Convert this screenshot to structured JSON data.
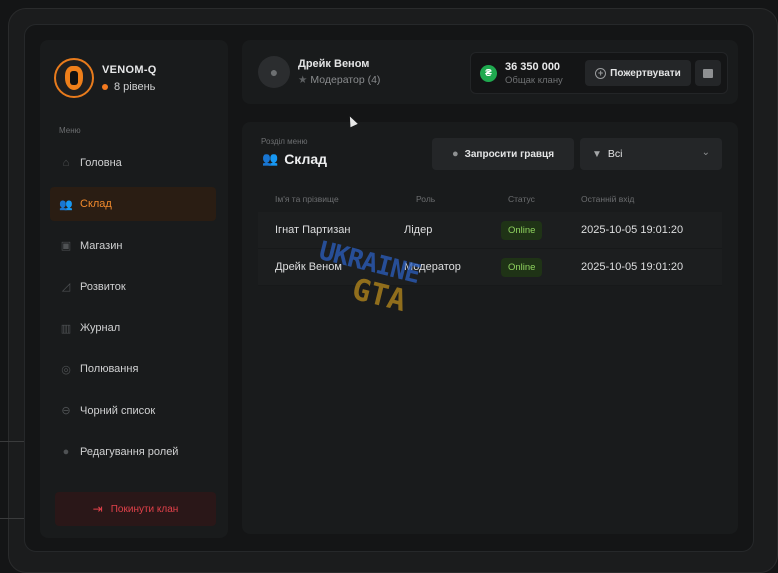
{
  "clan": {
    "name": "VENOM-Q",
    "level": "8 рівень"
  },
  "sidebar": {
    "menu_label": "Меню",
    "items": [
      {
        "label": "Головна",
        "icon": "home-icon"
      },
      {
        "label": "Склад",
        "icon": "users-icon",
        "active": true
      },
      {
        "label": "Магазин",
        "icon": "basket-icon"
      },
      {
        "label": "Розвиток",
        "icon": "chart-icon"
      },
      {
        "label": "Журнал",
        "icon": "book-icon"
      },
      {
        "label": "Полювання",
        "icon": "target-icon"
      },
      {
        "label": "Чорний список",
        "icon": "block-icon"
      },
      {
        "label": "Редагування ролей",
        "icon": "user-edit-icon"
      }
    ],
    "leave_label": "Покинути клан"
  },
  "user": {
    "name": "Дрейк Веном",
    "role": "Модератор (4)"
  },
  "balance": {
    "value": "36 350 000",
    "label": "Общак клану",
    "donate_label": "Пожертвувати"
  },
  "main": {
    "section_label": "Розділ меню",
    "title": "Склад",
    "invite_label": "Запросити гравця",
    "filter_value": "Всі",
    "columns": [
      "Ім'я та прізвище",
      "Роль",
      "Статус",
      "Останній вхід"
    ],
    "rows": [
      {
        "name": "Ігнат Партизан",
        "role": "Лідер",
        "status": "Online",
        "last": "2025-10-05 19:01:20"
      },
      {
        "name": "Дрейк Веном",
        "role": "Модератор",
        "status": "Online",
        "last": "2025-10-05 19:01:20"
      }
    ]
  },
  "watermark": {
    "top": "UKRAINE",
    "bottom": "GTA"
  },
  "colors": {
    "accent": "#f28a2c",
    "danger": "#e2414a",
    "online": "#8fd35f",
    "coin": "#1fa94f"
  }
}
